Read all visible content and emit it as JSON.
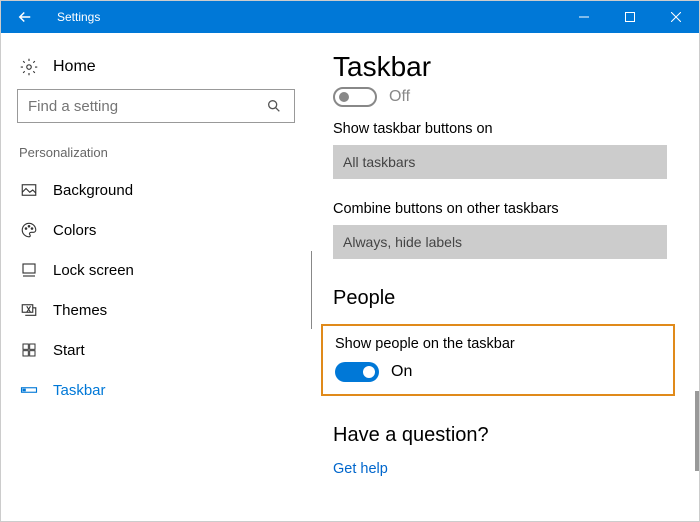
{
  "titlebar": {
    "title": "Settings"
  },
  "side": {
    "home_label": "Home",
    "search_placeholder": "Find a setting",
    "section_label": "Personalization",
    "items": [
      {
        "label": "Background"
      },
      {
        "label": "Colors"
      },
      {
        "label": "Lock screen"
      },
      {
        "label": "Themes"
      },
      {
        "label": "Start"
      },
      {
        "label": "Taskbar"
      }
    ]
  },
  "main": {
    "title": "Taskbar",
    "off_label": "Off",
    "settings": [
      {
        "label": "Show taskbar buttons on",
        "value": "All taskbars"
      },
      {
        "label": "Combine buttons on other taskbars",
        "value": "Always, hide labels"
      }
    ],
    "people_heading": "People",
    "people_toggle_label": "Show people on the taskbar",
    "on_label": "On",
    "help_heading": "Have a question?",
    "help_link": "Get help"
  }
}
